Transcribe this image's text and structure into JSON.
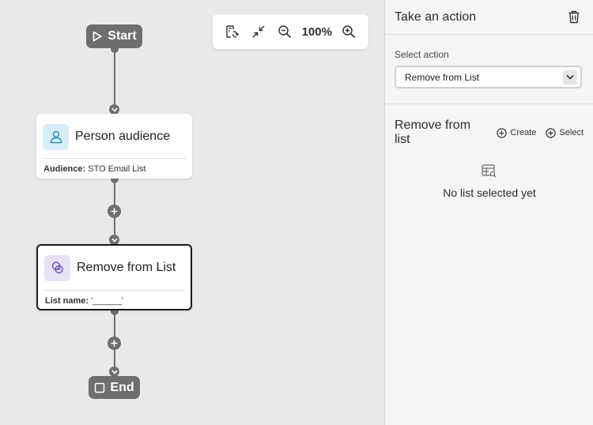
{
  "canvas": {
    "start_label": "Start",
    "end_label": "End",
    "toolbar": {
      "zoom": "100%"
    },
    "audience_card": {
      "title": "Person audience",
      "foot_label": "Audience:",
      "foot_value": "STO Email List"
    },
    "action_card": {
      "title": "Remove from List",
      "foot_label": "List name:",
      "foot_value": "'______'"
    }
  },
  "panel": {
    "title": "Take an action",
    "select_label": "Select action",
    "select_value": "Remove from List",
    "list_section_title": "Remove from list",
    "create_label": "Create",
    "select_btn_label": "Select",
    "empty_text": "No list selected yet"
  },
  "colors": {
    "node_gray": "#6e6e6e",
    "audience_icon_bg": "#d8eef7",
    "audience_icon": "#2a8fbd",
    "action_icon_bg": "#e7e3f5",
    "action_icon": "#6b4fbb"
  }
}
